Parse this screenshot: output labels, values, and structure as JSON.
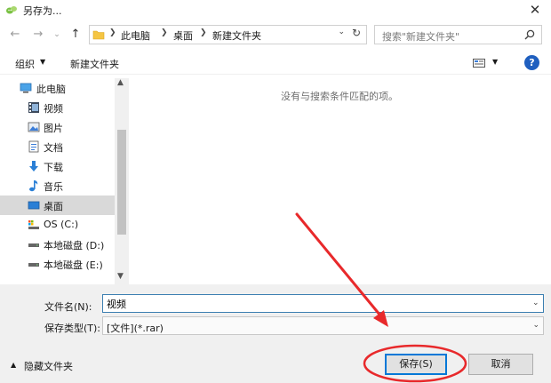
{
  "window": {
    "title": "另存为..."
  },
  "nav": {
    "back": "←",
    "forward": "→",
    "recent": "⌄",
    "up": "↑",
    "breadcrumbs": [
      "此电脑",
      "桌面",
      "新建文件夹"
    ],
    "search_placeholder": "搜索\"新建文件夹\""
  },
  "toolbar": {
    "organize": "组织",
    "new_folder": "新建文件夹",
    "help": "?"
  },
  "sidebar": {
    "items": [
      {
        "label": "此电脑",
        "icon": "computer-icon"
      },
      {
        "label": "视频",
        "icon": "video-folder-icon"
      },
      {
        "label": "图片",
        "icon": "picture-folder-icon"
      },
      {
        "label": "文档",
        "icon": "document-folder-icon"
      },
      {
        "label": "下载",
        "icon": "download-icon"
      },
      {
        "label": "音乐",
        "icon": "music-icon"
      },
      {
        "label": "桌面",
        "icon": "desktop-icon",
        "selected": true
      },
      {
        "label": "OS (C:)",
        "icon": "system-drive-icon"
      },
      {
        "label": "本地磁盘 (D:)",
        "icon": "drive-icon"
      },
      {
        "label": "本地磁盘 (E:)",
        "icon": "drive-icon"
      }
    ]
  },
  "content": {
    "empty_message": "没有与搜索条件匹配的项。"
  },
  "form": {
    "filename_label": "文件名(N):",
    "filename_value": "视频",
    "filetype_label": "保存类型(T):",
    "filetype_value": "[文件](*.rar)"
  },
  "footer": {
    "hide_folders": "隐藏文件夹",
    "save": "保存(S)",
    "cancel": "取消"
  },
  "colors": {
    "accent": "#0078d7",
    "annotation": "#e8292b",
    "help": "#1f5fbf",
    "folder": "#f5c542"
  }
}
